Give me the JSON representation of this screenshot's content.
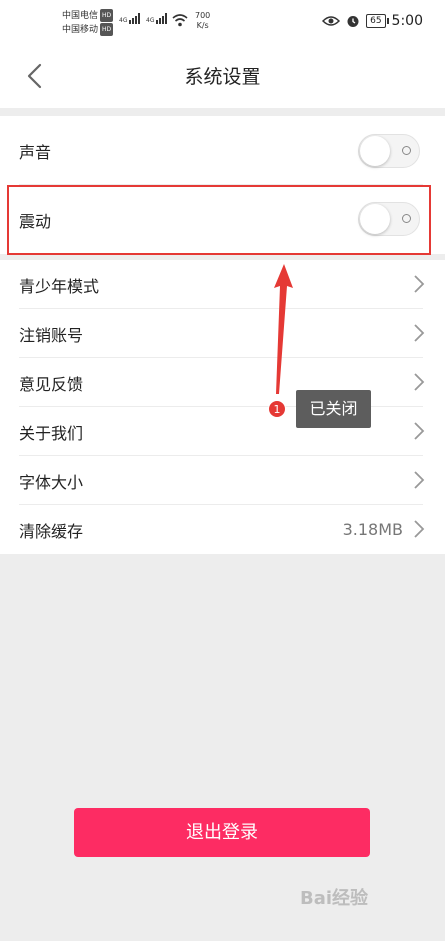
{
  "status_bar": {
    "carrier1": "中国电信",
    "carrier2": "中国移动",
    "hd": "HD",
    "net_type": "4G",
    "speed_value": "700",
    "speed_unit": "K/s",
    "battery": "65",
    "time": "5:00"
  },
  "header": {
    "title": "系统设置"
  },
  "toggles": [
    {
      "label": "声音",
      "on": false
    },
    {
      "label": "震动",
      "on": false
    }
  ],
  "menu": [
    {
      "label": "青少年模式"
    },
    {
      "label": "注销账号"
    },
    {
      "label": "意见反馈"
    },
    {
      "label": "关于我们"
    },
    {
      "label": "字体大小"
    },
    {
      "label": "清除缓存",
      "value": "3.18MB"
    }
  ],
  "annotation": {
    "badge": "1",
    "text": "已关闭",
    "color": "#e53935"
  },
  "logout_label": "退出登录",
  "colors": {
    "accent": "#fd2c63",
    "highlight": "#e53935"
  },
  "watermark": "Bai经验"
}
